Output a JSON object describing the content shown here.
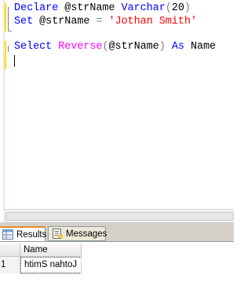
{
  "editor": {
    "lines": [
      {
        "tokens": [
          {
            "cls": "kw",
            "text": "Declare"
          },
          {
            "cls": "",
            "text": " @strName "
          },
          {
            "cls": "kw",
            "text": "Varchar"
          },
          {
            "cls": "op",
            "text": "("
          },
          {
            "cls": "",
            "text": "20"
          },
          {
            "cls": "op",
            "text": ")"
          }
        ]
      },
      {
        "tokens": [
          {
            "cls": "kw",
            "text": "Set"
          },
          {
            "cls": "",
            "text": " @strName "
          },
          {
            "cls": "op",
            "text": "="
          },
          {
            "cls": "",
            "text": " "
          },
          {
            "cls": "str",
            "text": "'Jothan Smith'"
          }
        ]
      },
      {
        "tokens": []
      },
      {
        "tokens": [
          {
            "cls": "kw",
            "text": "Select"
          },
          {
            "cls": "",
            "text": " "
          },
          {
            "cls": "fn",
            "text": "Reverse"
          },
          {
            "cls": "op",
            "text": "("
          },
          {
            "cls": "",
            "text": "@strName"
          },
          {
            "cls": "op",
            "text": ")"
          },
          {
            "cls": "",
            "text": " "
          },
          {
            "cls": "kw",
            "text": "As"
          },
          {
            "cls": "",
            "text": " Name"
          }
        ]
      }
    ]
  },
  "tabs": {
    "results_label": "Results",
    "messages_label": "Messages",
    "active": "Results"
  },
  "grid": {
    "columns": [
      "Name"
    ],
    "rows": [
      {
        "row_number": "1",
        "cells": [
          "htimS nahtoJ"
        ]
      }
    ]
  },
  "colors": {
    "keyword": "#0000ff",
    "function": "#ff00ff",
    "string": "#ff0000",
    "change_bar": "#ffde00"
  }
}
